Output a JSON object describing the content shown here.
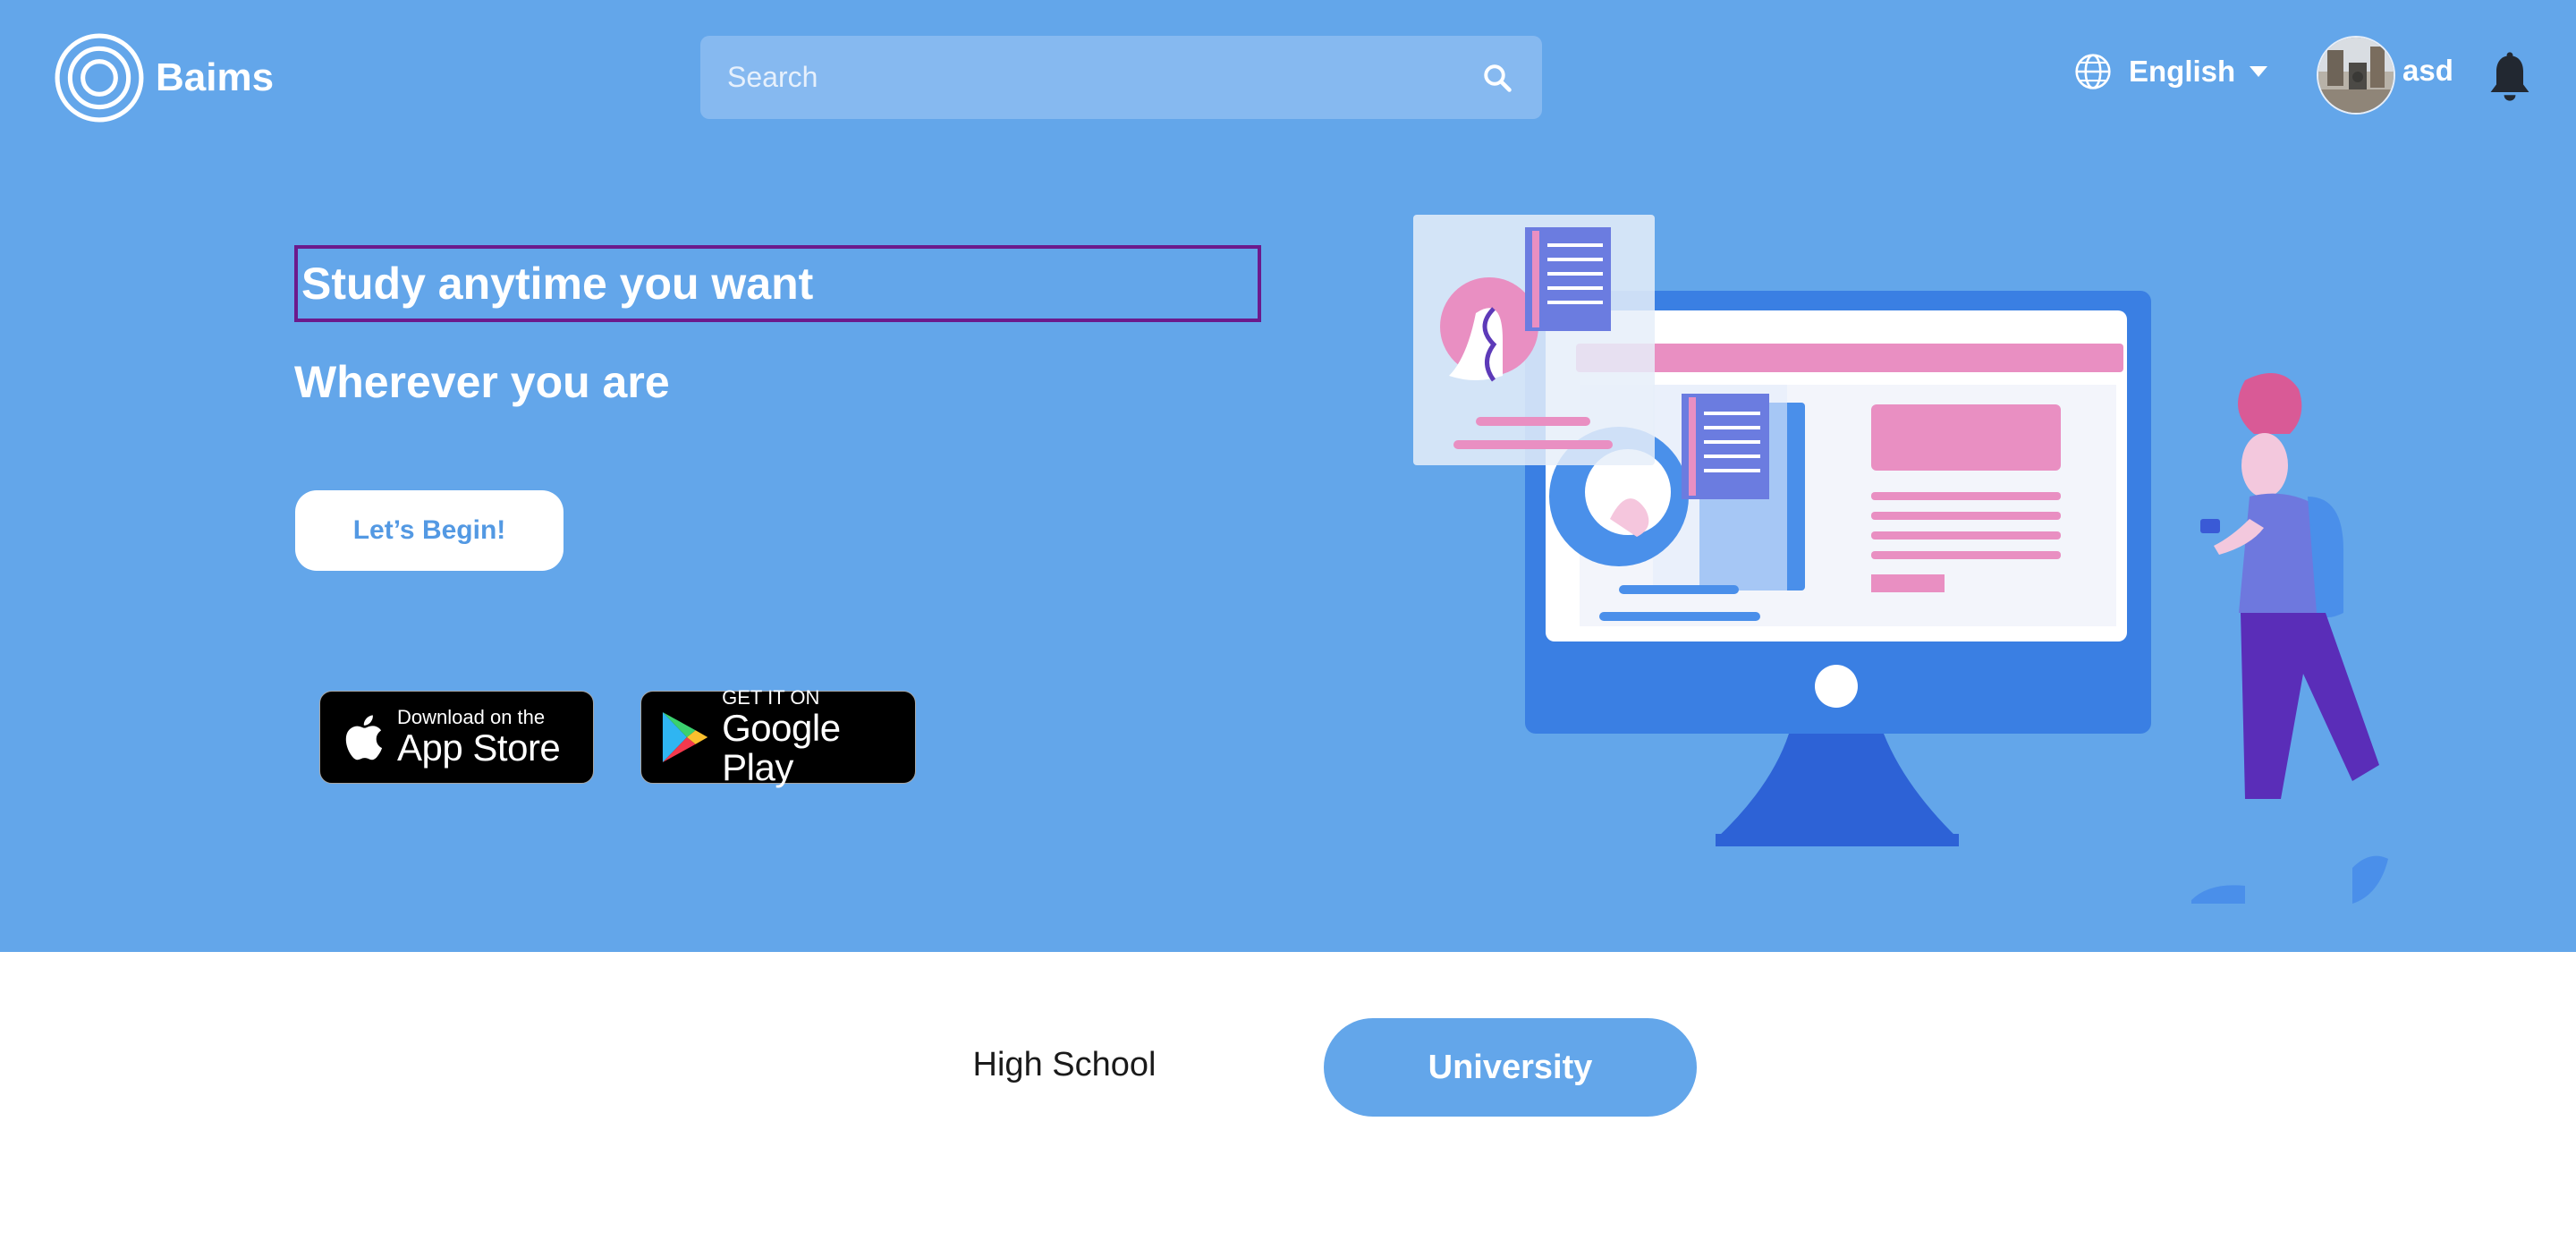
{
  "header": {
    "brand": "Baims",
    "search_placeholder": "Search",
    "language": "English",
    "user_name": "asd"
  },
  "hero": {
    "headline": "Study anytime you want",
    "subheadline": "Wherever you are",
    "cta_label": "Let’s Begin!",
    "app_store": {
      "small": "Download on the",
      "big": "App Store"
    },
    "google_play": {
      "small": "GET IT ON",
      "big": "Google Play"
    }
  },
  "tabs": [
    {
      "label": "High School",
      "active": false
    },
    {
      "label": "University",
      "active": true
    }
  ],
  "colors": {
    "hero_bg": "#63a6ea",
    "search_bg": "#86b9f0",
    "cta_text": "#5399e3",
    "headline_border": "#6c1a8c"
  },
  "icons": [
    "baims-logo-icon",
    "search-icon",
    "globe-icon",
    "chevron-down-icon",
    "bell-icon",
    "apple-icon",
    "google-play-icon"
  ]
}
